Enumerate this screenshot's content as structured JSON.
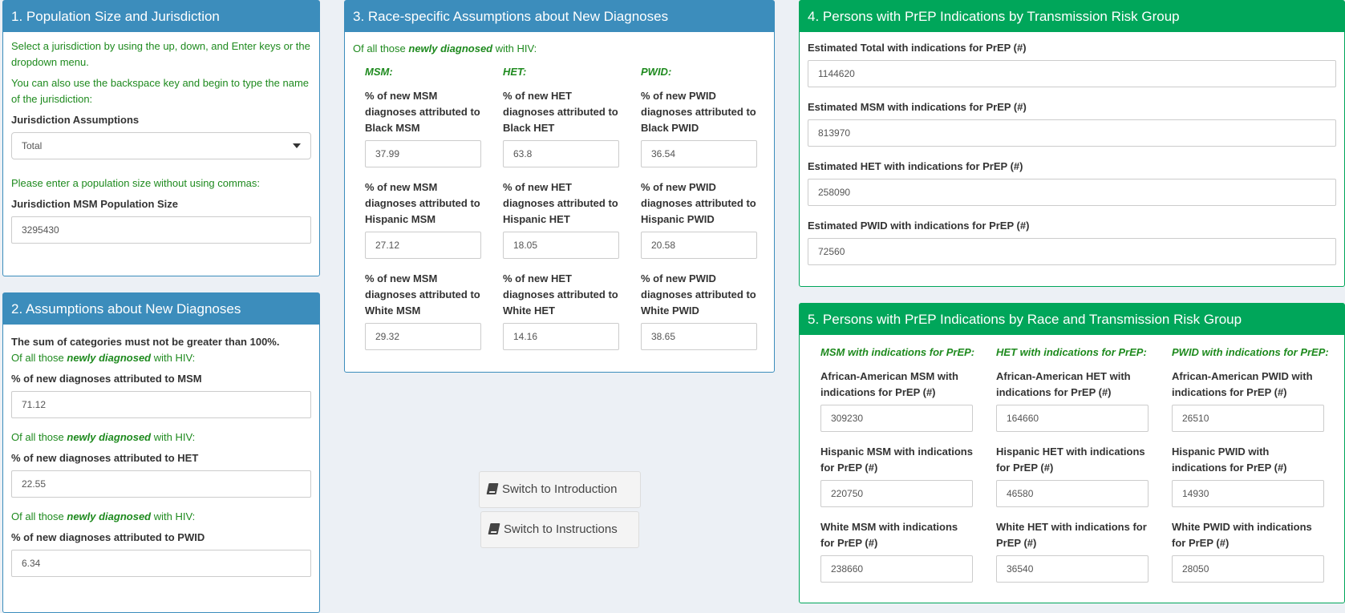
{
  "box1": {
    "title": "1. Population Size and Jurisdiction",
    "note1": "Select a jurisdiction by using the up, down, and Enter keys or the dropdown menu.",
    "note2": "You can also use the backspace key and begin to type the name of the jurisdiction:",
    "jurisdiction_label": "Jurisdiction Assumptions",
    "jurisdiction_value": "Total",
    "note3": "Please enter a population size without using commas:",
    "pop_label": "Jurisdiction MSM Population Size",
    "pop_value": "3295430"
  },
  "box2": {
    "title": "2. Assumptions about New Diagnoses",
    "warning": "The sum of categories must not be greater than 100%.",
    "of_all_prefix": "Of all those ",
    "of_all_em": "newly diagnosed",
    "of_all_suffix": " with HIV:",
    "fields": [
      {
        "label": "% of new diagnoses attributed to MSM",
        "value": "71.12"
      },
      {
        "label": "% of new diagnoses attributed to HET",
        "value": "22.55"
      },
      {
        "label": "% of new diagnoses attributed to PWID",
        "value": "6.34"
      }
    ]
  },
  "box3": {
    "title": "3. Race-specific Assumptions about New Diagnoses",
    "of_all_prefix": "Of all those ",
    "of_all_em": "newly diagnosed",
    "of_all_suffix": " with HIV:",
    "columns": [
      {
        "head": "MSM:",
        "rows": [
          {
            "label": "% of new MSM diagnoses attributed to Black MSM",
            "value": "37.99"
          },
          {
            "label": "% of new MSM diagnoses attributed to Hispanic MSM",
            "value": "27.12"
          },
          {
            "label": "% of new MSM diagnoses attributed to White MSM",
            "value": "29.32"
          }
        ]
      },
      {
        "head": "HET:",
        "rows": [
          {
            "label": "% of new HET diagnoses attributed to Black HET",
            "value": "63.8"
          },
          {
            "label": "% of new HET diagnoses attributed to Hispanic HET",
            "value": "18.05"
          },
          {
            "label": "% of new HET diagnoses attributed to White HET",
            "value": "14.16"
          }
        ]
      },
      {
        "head": "PWID:",
        "rows": [
          {
            "label": "% of new PWID diagnoses attributed to Black PWID",
            "value": "36.54"
          },
          {
            "label": "% of new PWID diagnoses attributed to Hispanic PWID",
            "value": "20.58"
          },
          {
            "label": "% of new PWID diagnoses attributed to White PWID",
            "value": "38.65"
          }
        ]
      }
    ]
  },
  "buttons": {
    "intro": "Switch to Introduction",
    "instructions": "Switch to Instructions"
  },
  "box4": {
    "title": "4. Persons with PrEP Indications by Transmission Risk Group",
    "fields": [
      {
        "label": "Estimated Total with indications for PrEP (#)",
        "value": "1144620"
      },
      {
        "label": "Estimated MSM with indications for PrEP (#)",
        "value": "813970"
      },
      {
        "label": "Estimated HET with indications for PrEP (#)",
        "value": "258090"
      },
      {
        "label": "Estimated PWID with indications for PrEP (#)",
        "value": "72560"
      }
    ]
  },
  "box5": {
    "title": "5. Persons with PrEP Indications by Race and Transmission Risk Group",
    "columns": [
      {
        "head": "MSM with indications for PrEP:",
        "rows": [
          {
            "label": "African-American MSM with indications for PrEP (#)",
            "value": "309230"
          },
          {
            "label": "Hispanic MSM with indications for PrEP (#)",
            "value": "220750"
          },
          {
            "label": "White MSM with indications for PrEP (#)",
            "value": "238660"
          }
        ]
      },
      {
        "head": "HET with indications for PrEP:",
        "rows": [
          {
            "label": "African-American HET with indications for PrEP (#)",
            "value": "164660"
          },
          {
            "label": "Hispanic HET with indications for PrEP (#)",
            "value": "46580"
          },
          {
            "label": "White HET with indications for PrEP (#)",
            "value": "36540"
          }
        ]
      },
      {
        "head": "PWID with indications for PrEP:",
        "rows": [
          {
            "label": "African-American PWID with indications for PrEP (#)",
            "value": "26510"
          },
          {
            "label": "Hispanic PWID with indications for PrEP (#)",
            "value": "14930"
          },
          {
            "label": "White PWID with indications for PrEP (#)",
            "value": "28050"
          }
        ]
      }
    ]
  }
}
